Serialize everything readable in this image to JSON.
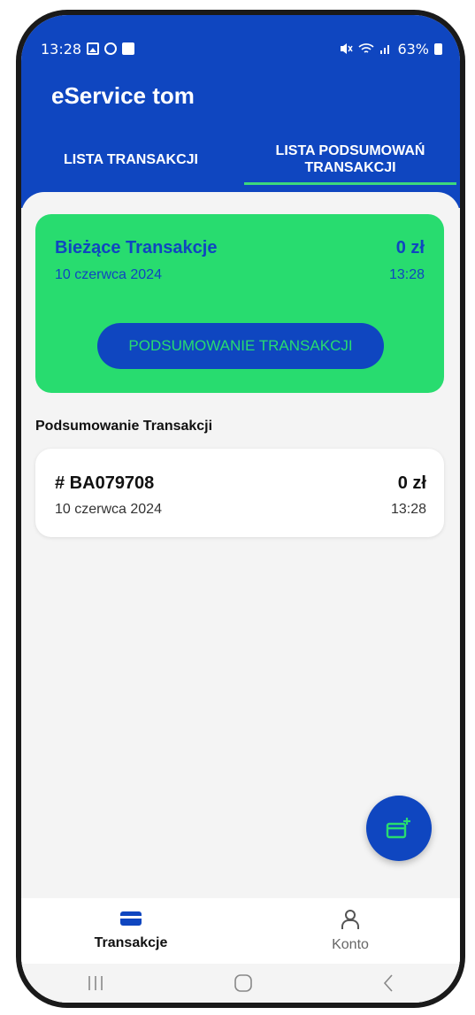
{
  "statusbar": {
    "time": "13:28",
    "battery": "63%"
  },
  "app": {
    "title": "eService tom"
  },
  "tabs": [
    {
      "label": "LISTA TRANSAKCJI",
      "active": false
    },
    {
      "label": "LISTA PODSUMOWAŃ TRANSAKCJI",
      "active": true
    }
  ],
  "current": {
    "title": "Bieżące Transakcje",
    "amount": "0 zł",
    "date": "10 czerwca 2024",
    "time": "13:28",
    "button_label": "PODSUMOWANIE TRANSAKCJI"
  },
  "section": {
    "title": "Podsumowanie Transakcji"
  },
  "transactions": [
    {
      "id": "# BA079708",
      "amount": "0 zł",
      "date": "10 czerwca 2024",
      "time": "13:28"
    }
  ],
  "fab": {
    "icon": "add-card-icon"
  },
  "bottom_nav": [
    {
      "label": "Transakcje",
      "icon": "card-icon",
      "active": true
    },
    {
      "label": "Konto",
      "icon": "person-icon",
      "active": false
    }
  ],
  "colors": {
    "primary": "#0f46c0",
    "accent": "#28dc6f",
    "background": "#f4f4f4"
  }
}
